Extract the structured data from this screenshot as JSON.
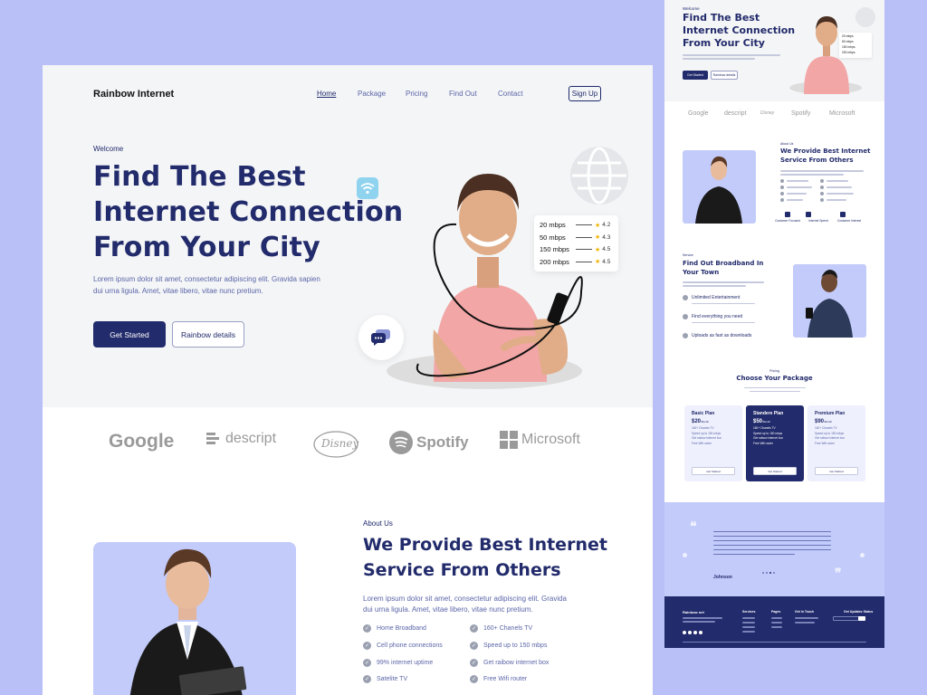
{
  "nav": {
    "brand": "Rainbow Internet",
    "links": [
      "Home",
      "Package",
      "Pricing",
      "Find Out",
      "Contact"
    ],
    "signup": "Sign Up"
  },
  "hero": {
    "welcome": "Welcome",
    "title_lines": [
      "Find The Best",
      "Internet Connection",
      "From Your City"
    ],
    "description_lines": [
      "Lorem ipsum dolor sit amet, consectetur adipiscing elit. Gravida sapien",
      "dui urna ligula. Amet, vitae libero, vitae nunc pretium."
    ],
    "primary_button": "Get Started",
    "secondary_button": "Rainbow details",
    "speeds": [
      {
        "speed": "20 mbps",
        "rating": "4.2"
      },
      {
        "speed": "50 mbps",
        "rating": "4.3"
      },
      {
        "speed": "150 mbps",
        "rating": "4.5"
      },
      {
        "speed": "200 mbps",
        "rating": "4.5"
      }
    ]
  },
  "logos": [
    "Google",
    "descript",
    "Disney",
    "Spotify",
    "Microsoft"
  ],
  "about": {
    "label": "About Us",
    "title_lines": [
      "We Provide Best Internet",
      "Service From Others"
    ],
    "description_lines": [
      "Lorem ipsum dolor sit amet, consectetur adipiscing elit. Gravida",
      "dui urna ligula. Amet, vitae libero, vitae nunc pretium."
    ],
    "features": [
      "Home Broadband",
      "160+ Chanels TV",
      "Cell phone connections",
      "Speed up to 150 mbps",
      "99% internet uptime",
      "Get raibow internet box",
      "Satelite TV",
      "Free Wifi router"
    ]
  },
  "side": {
    "welcome": "Welcome",
    "title_lines": [
      "Find The Best",
      "Internet Connection",
      "From Your City"
    ],
    "btn_primary": "Get Started",
    "btn_secondary": "Rainbow details",
    "speeds": [
      "20 mbps",
      "50 mbps",
      "150 mbps",
      "200 mbps"
    ],
    "logos": [
      "Google",
      "descript",
      "Disney",
      "Spotify",
      "Microsoft"
    ],
    "about_label": "About Us",
    "about_title_lines": [
      "We Provide Best Internet",
      "Service From Others"
    ],
    "about_icons": [
      "Customer Focused",
      "Internet Speed",
      "Customer Interest"
    ],
    "broadband_label": "Service",
    "broadband_title_lines": [
      "Find Out Broadband In",
      "Your Town"
    ],
    "broadband_items": [
      "Unlimited Entertainment",
      "Find everything you need",
      "Uploads as fast as downloads"
    ],
    "package_label": "Pricing",
    "package_title": "Choose Your Package",
    "plans": [
      {
        "name": "Basic Plan",
        "price": "$20",
        "unit": "/Month",
        "features": [
          "160+ Chanels TV",
          "Speed up to 150 mbps",
          "Get raibow internet box",
          "Free Wifi router"
        ],
        "button": "Get Started"
      },
      {
        "name": "Standere Plan",
        "price": "$50",
        "unit": "/Month",
        "features": [
          "160+ Chanels TV",
          "Speed up to 150 mbps",
          "Get raibow internet box",
          "Free Wifi router"
        ],
        "button": "Get Started"
      },
      {
        "name": "Premium Plan",
        "price": "$90",
        "unit": "/Month",
        "features": [
          "160+ Chanels TV",
          "Speed up to 150 mbps",
          "Get raibow internet box",
          "Free Wifi router"
        ],
        "button": "Get Started"
      }
    ],
    "testimonial_name": "Johnson",
    "footer_brand": "Rainbow net",
    "footer_cols": [
      "Services",
      "Pages",
      "Get In Touch",
      "Get Updates Status"
    ]
  },
  "colors": {
    "page_bg": "#b9c0f7",
    "primary": "#222b6b",
    "accent_light": "#c3cbfa",
    "star": "#f1b400"
  }
}
